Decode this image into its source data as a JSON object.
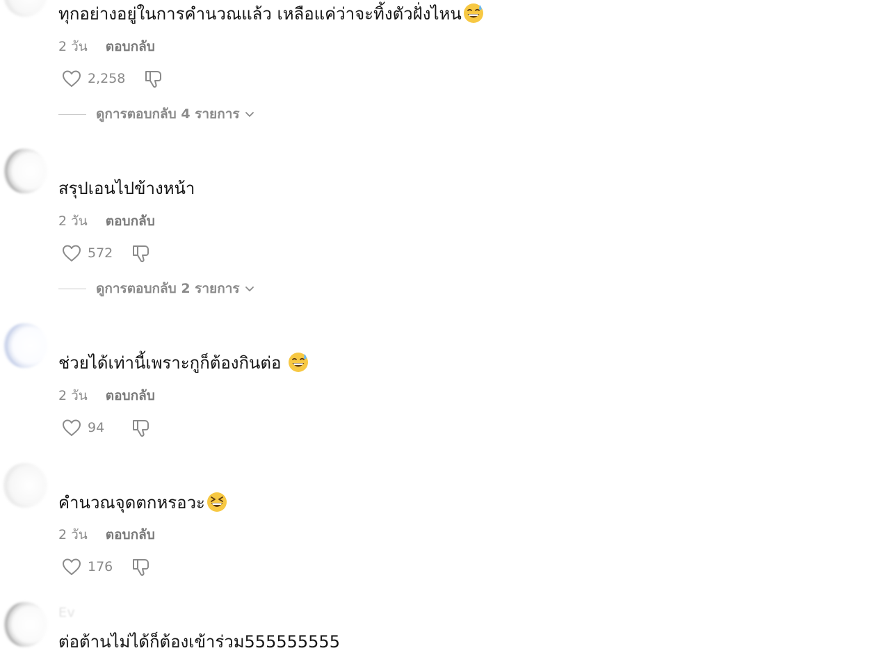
{
  "comments": [
    {
      "text": "ทุกอย่างอยู่ในการคำนวณแล้ว เหลือแค่ว่าจะทิ้งตัวฝั่งไหน",
      "emoji": "grinning-sweat-emoji",
      "time": "2 วัน",
      "reply": "ตอบกลับ",
      "likes": "2,258",
      "view_replies": "ดูการตอบกลับ 4 รายการ"
    },
    {
      "text": "สรุปเอนไปข้างหน้า",
      "time": "2 วัน",
      "reply": "ตอบกลับ",
      "likes": "572",
      "view_replies": "ดูการตอบกลับ 2 รายการ"
    },
    {
      "text": "ช่วยได้เท่านี้เพราะกูก็ต้องกินต่อ ",
      "emoji": "grinning-sweat-emoji",
      "time": "2 วัน",
      "reply": "ตอบกลับ",
      "likes": "94"
    },
    {
      "text": "คำนวณจุดตกหรอวะ",
      "emoji": "laughing-squint-emoji",
      "time": "2 วัน",
      "reply": "ตอบกลับ",
      "likes": "176"
    },
    {
      "username": "Ev",
      "text": "ต่อต้านไม่ได้ก็ต้องเข้าร่วม555555555"
    }
  ],
  "colors": {
    "text": "#161616",
    "meta": "#8a8a8a",
    "divider": "#c8c8c8",
    "emoji_face": "#f7c843"
  },
  "icons": [
    "heart-outline-icon",
    "thumbs-down-icon",
    "chevron-down-icon"
  ]
}
